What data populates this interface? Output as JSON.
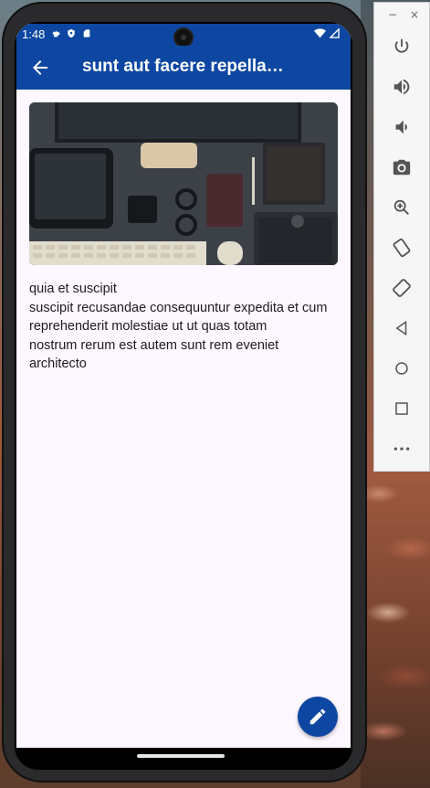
{
  "status_bar": {
    "time": "1:48"
  },
  "app_bar": {
    "title": "sunt aut facere repella…"
  },
  "article": {
    "image_alt": "desk-workspace-photo",
    "lines": [
      "quia et suscipit",
      "suscipit recusandae consequuntur expedita et cum",
      "reprehenderit molestiae ut ut quas totam",
      "nostrum rerum est autem sunt rem eveniet",
      "architecto"
    ]
  },
  "fab": {
    "icon": "edit-icon"
  },
  "emulator_panel": {
    "minimize": "−",
    "close": "×",
    "controls": [
      "power-icon",
      "volume-up-icon",
      "volume-down-icon",
      "camera-icon",
      "zoom-icon",
      "rotate-left-icon",
      "rotate-right-icon",
      "back-icon",
      "home-icon",
      "overview-icon",
      "more-icon"
    ]
  },
  "colors": {
    "primary": "#0d47a1",
    "surface": "#fdf7ff",
    "text": "#1d1b20"
  }
}
